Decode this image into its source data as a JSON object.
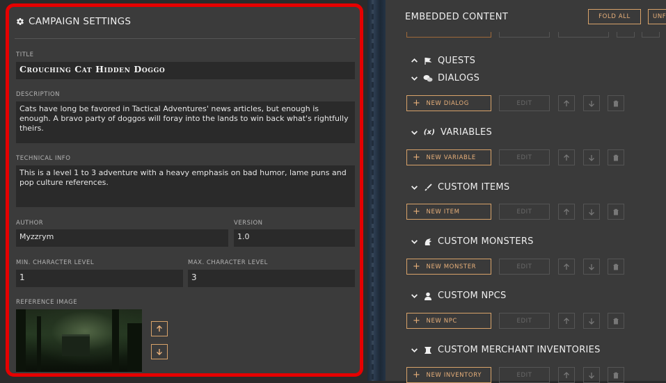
{
  "campaign": {
    "header": "CAMPAIGN SETTINGS",
    "title_label": "TITLE",
    "title_value": "Crouching Cat Hidden Doggo",
    "description_label": "DESCRIPTION",
    "description_value": "Cats have long be favored in Tactical Adventures' news articles, but enough is enough. A bravo party of doggos will foray into the lands to win back what's rightfully theirs.",
    "technical_label": "TECHNICAL INFO",
    "technical_value": "This is a level 1 to 3 adventure with a heavy emphasis on bad humor, lame puns and pop culture references.",
    "author_label": "AUTHOR",
    "author_value": "Myzzrym",
    "version_label": "VERSION",
    "version_value": "1.0",
    "min_level_label": "MIN. CHARACTER LEVEL",
    "min_level_value": "1",
    "max_level_label": "MAX. CHARACTER LEVEL",
    "max_level_value": "3",
    "reference_label": "REFERENCE IMAGE"
  },
  "embedded": {
    "header": "EMBEDDED CONTENT",
    "fold_all": "FOLD ALL",
    "unfold_all": "UNF",
    "edit_label": "EDIT",
    "sections": [
      {
        "title": "QUESTS",
        "icon": "flag-icon"
      },
      {
        "title": "DIALOGS",
        "icon": "speech-bubbles-icon",
        "new_label": "NEW DIALOG"
      },
      {
        "title": "VARIABLES",
        "icon": "variable-icon",
        "new_label": "NEW VARIABLE"
      },
      {
        "title": "CUSTOM ITEMS",
        "icon": "sword-icon",
        "new_label": "NEW ITEM"
      },
      {
        "title": "CUSTOM MONSTERS",
        "icon": "monster-icon",
        "new_label": "NEW MONSTER"
      },
      {
        "title": "CUSTOM NPCS",
        "icon": "person-icon",
        "new_label": "NEW NPC"
      },
      {
        "title": "CUSTOM MERCHANT INVENTORIES",
        "icon": "inventory-icon",
        "new_label": "NEW INVENTORY"
      }
    ],
    "variable_glyph": "(x)"
  },
  "colors": {
    "highlight_border": "#e60000",
    "accent": "#e8b07a",
    "panel_bg": "#3b3b3b",
    "field_bg": "#2a2a2a"
  }
}
